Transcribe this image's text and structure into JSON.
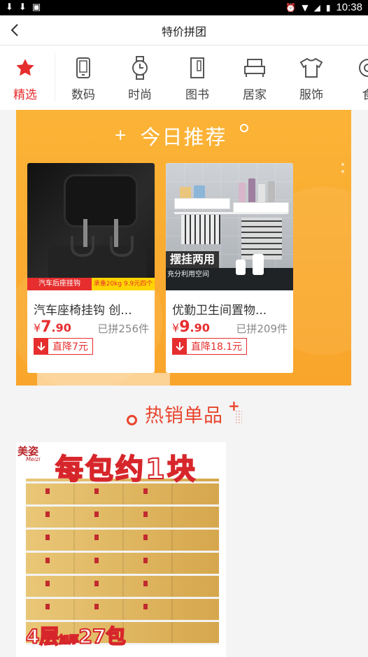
{
  "status_bar": {
    "time": "10:38",
    "left_icons": [
      "download-icon",
      "download-icon",
      "notification-icon"
    ],
    "right_icons": [
      "alarm-icon",
      "wifi-icon",
      "signal-icon",
      "battery-icon"
    ]
  },
  "header": {
    "title": "特价拼团"
  },
  "categories": [
    {
      "label": "精选",
      "icon": "star-icon",
      "active": true
    },
    {
      "label": "数码",
      "icon": "phone-icon"
    },
    {
      "label": "时尚",
      "icon": "watch-icon"
    },
    {
      "label": "图书",
      "icon": "book-icon"
    },
    {
      "label": "居家",
      "icon": "bed-icon"
    },
    {
      "label": "服饰",
      "icon": "shirt-icon"
    },
    {
      "label": "食",
      "icon": "food-icon"
    }
  ],
  "recommend": {
    "title": "今日推荐",
    "products": [
      {
        "name": "汽车座椅挂钩 创...",
        "price_currency": "¥",
        "price_int": "7",
        "price_dec": ".90",
        "sold": "已拼256件",
        "drop": "直降7元",
        "image_tag_left": "汽车后座挂钩",
        "image_tag_right": "承重20kg 9.9元四个"
      },
      {
        "name": "优勤卫生间置物...",
        "price_currency": "¥",
        "price_int": "9",
        "price_dec": ".90",
        "sold": "已拼209件",
        "drop": "直降18.1元",
        "image_label": "摆挂两用",
        "image_sublabel": "充分利用空间"
      }
    ]
  },
  "hot": {
    "title": "热销单品",
    "product": {
      "brand": "美姿",
      "brand_sub": "Meizi",
      "slogan": "每包约1块",
      "bottom_text_a": "4层",
      "bottom_text_b": "加厚",
      "bottom_text_c": "27包"
    }
  },
  "colors": {
    "accent": "#e62e2e",
    "banner": "#fbb336",
    "hot_title": "#e8452e"
  }
}
